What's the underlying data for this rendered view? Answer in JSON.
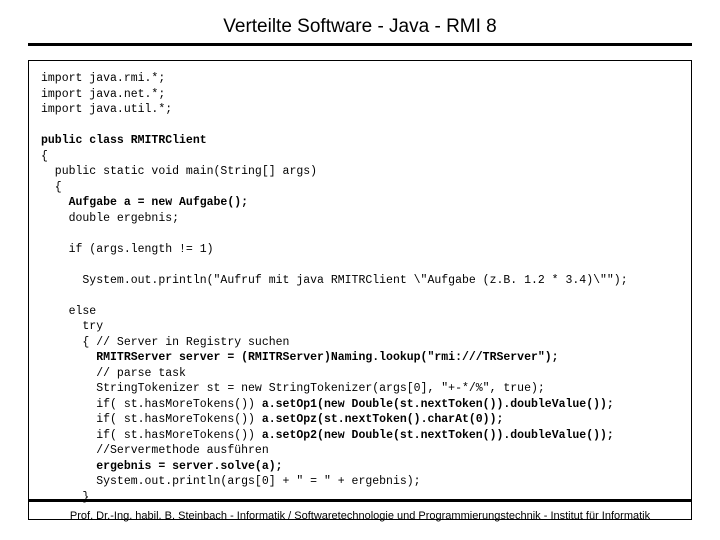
{
  "header": {
    "title": "Verteilte Software - Java - RMI 8"
  },
  "code": {
    "l01": "import java.rmi.*;",
    "l02": "import java.net.*;",
    "l03": "import java.util.*;",
    "l04": "public class RMITRClient",
    "l05": "{",
    "l06": "  public static void main(String[] args)",
    "l07": "  {",
    "l08_b": "    Aufgabe a = new Aufgabe();",
    "l09": "    double ergebnis;",
    "l10": "    if (args.length != 1)",
    "l11": "      System.out.println(\"Aufruf mit java RMITRClient \\\"Aufgabe (z.B. 1.2 * 3.4)\\\"\");",
    "l12": "    else",
    "l13": "      try",
    "l14": "      { // Server in Registry suchen",
    "l15_b": "        RMITRServer server = (RMITRServer)Naming.lookup(\"rmi:///TRServer\");",
    "l16": "        // parse task",
    "l17": "        StringTokenizer st = new StringTokenizer(args[0], \"+-*/%\", true);",
    "l18a": "        if( st.hasMoreTokens()) ",
    "l18b": "a.setOp1(new Double(st.nextToken()).doubleValue());",
    "l19a": "        if( st.hasMoreTokens()) ",
    "l19b": "a.setOpz(st.nextToken().charAt(0));",
    "l20a": "        if( st.hasMoreTokens()) ",
    "l20b": "a.setOp2(new Double(st.nextToken()).doubleValue());",
    "l21": "        //Servermethode ausführen",
    "l22_b": "        ergebnis = server.solve(a);",
    "l23": "        System.out.println(args[0] + \" = \" + ergebnis);",
    "l24": "      }"
  },
  "footer": {
    "text": "Prof. Dr.-Ing. habil. B. Steinbach - Informatik / Softwaretechnologie und Programmierungstechnik - Institut für Informatik"
  }
}
